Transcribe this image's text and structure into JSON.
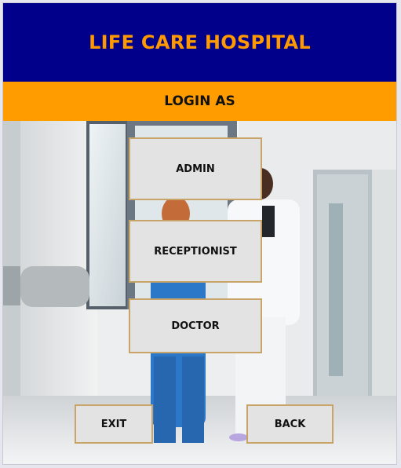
{
  "header": {
    "title": "LIFE CARE HOSPITAL"
  },
  "subheader": {
    "title": "LOGIN AS"
  },
  "roles": {
    "admin_label": "ADMIN",
    "receptionist_label": "RECEPTIONIST",
    "doctor_label": "DOCTOR"
  },
  "actions": {
    "exit_label": "EXIT",
    "back_label": "BACK"
  },
  "colors": {
    "header_bg": "#00008b",
    "header_text": "#ff9900",
    "subheader_bg": "#ff9c00",
    "button_bg": "#e3e3e3",
    "button_border": "#c8a468"
  },
  "background_image": "hospital-corridor-doctor-nurse-photo"
}
